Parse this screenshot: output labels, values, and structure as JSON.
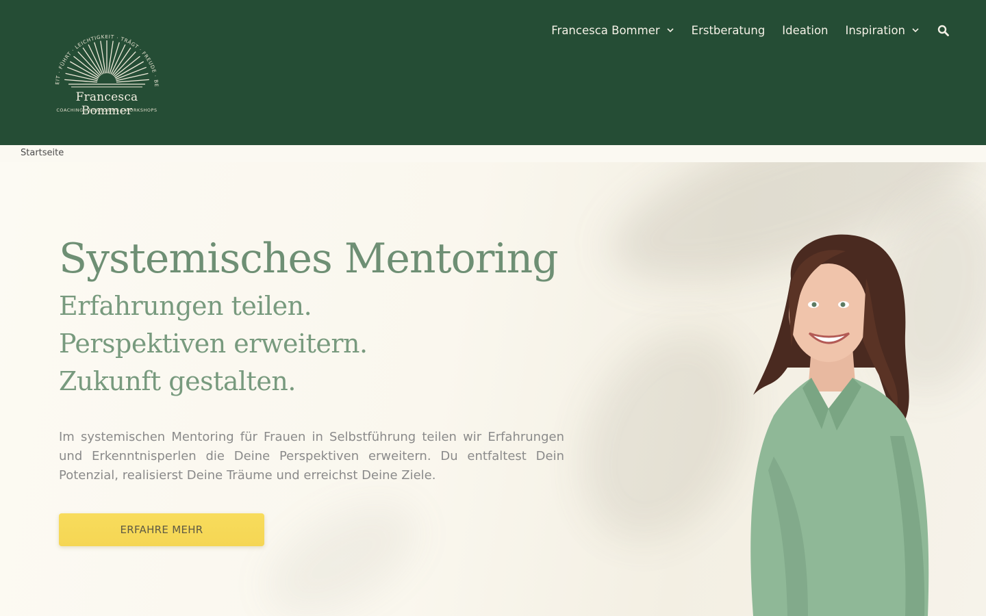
{
  "brand": {
    "arc_text": "KLARHEIT · FÜHRT · LEICHTIGKEIT · TRÄGT · FREUDE · BEWEGT",
    "name": "Francesca Bommer",
    "tagline": "COACHING | MENTORING | WORKSHOPS"
  },
  "nav": {
    "items": [
      {
        "label": "Francesca Bommer",
        "has_dropdown": true
      },
      {
        "label": "Erstberatung",
        "has_dropdown": false
      },
      {
        "label": "Ideation",
        "has_dropdown": false
      },
      {
        "label": "Inspiration",
        "has_dropdown": true
      }
    ],
    "search_icon": "search-icon"
  },
  "breadcrumb": {
    "label": "Startseite"
  },
  "hero": {
    "title": "Systemisches Mentoring",
    "lines": [
      "Erfahrungen teilen.",
      "Perspektiven erweitern.",
      "Zukunft gestalten."
    ],
    "text": "Im systemischen Mentoring für Frauen in Selbstführung teilen wir Erfahrungen und Erkenntnisperlen die Deine Perspektiven erweitern. Du entfaltest Dein Potenzial, realisierst Deine Träume und erreichst Deine Ziele.",
    "cta_label": "ERFAHRE MEHR"
  },
  "colors": {
    "header_bg": "#254d35",
    "heading": "#6e8f74",
    "cta": "#f7da58",
    "page_bg": "#fbf9f2"
  }
}
